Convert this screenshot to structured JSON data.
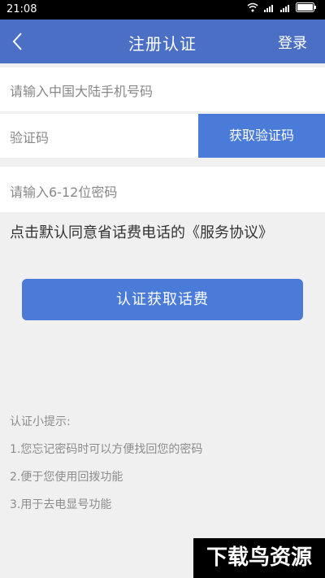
{
  "statusbar": {
    "time": "21:08"
  },
  "header": {
    "title": "注册认证",
    "login_label": "登录"
  },
  "form": {
    "phone_placeholder": "请输入中国大陆手机号码",
    "code_placeholder": "验证码",
    "get_code_label": "获取验证码",
    "password_placeholder": "请输入6-12位密码"
  },
  "agreement_text": "点击默认同意省话费电话的《服务协议》",
  "submit_label": "认证获取话费",
  "tips": {
    "title": "认证小提示:",
    "items": [
      "1.您忘记密码时可以方便找回您的密码",
      "2.便于您使用回拨功能",
      "3.用于去电显号功能"
    ]
  },
  "watermark": "下载鸟资源",
  "colors": {
    "header": "#4a6fc5",
    "button": "#4a7bd8",
    "background": "#f0f0f0"
  }
}
